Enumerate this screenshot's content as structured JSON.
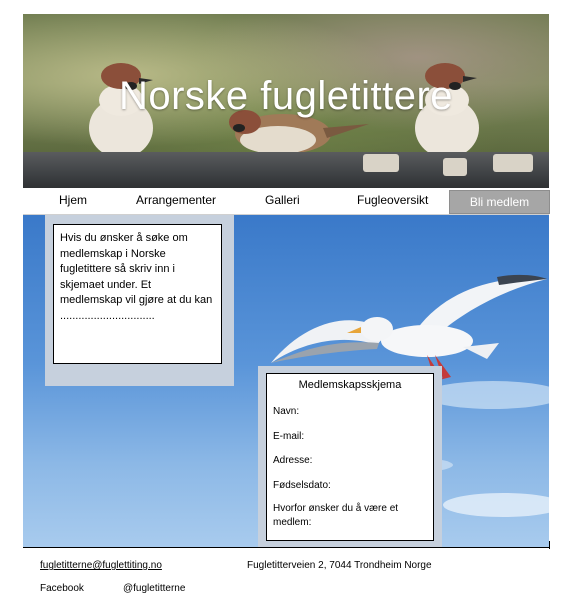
{
  "header": {
    "title": "Norske fugletittere"
  },
  "nav": {
    "items": [
      "Hjem",
      "Arrangementer",
      "Galleri",
      "Fugleoversikt"
    ],
    "join_label": "Bli medlem"
  },
  "intro": {
    "text": "Hvis du ønsker å søke om medlemskap i Norske fugletittere så skriv inn i skjemaet under. Et medlemskap vil gjøre at du kan ..............................."
  },
  "form": {
    "title": "Medlemskapsskjema",
    "fields": [
      "Navn:",
      "E-mail:",
      "Adresse:",
      "Fødselsdato:",
      "Hvorfor ønsker du å være et medlem:"
    ]
  },
  "footer": {
    "email": "fugletitterne@fuglettiting.no",
    "address": "Fugletitterveien 2, 7044 Trondheim Norge",
    "facebook_label": "Facebook",
    "facebook_handle": "@fugletitterne"
  },
  "colors": {
    "sky": "#4a88d2",
    "panel": "#c6d0dd",
    "join_button": "#a6a6a6"
  }
}
